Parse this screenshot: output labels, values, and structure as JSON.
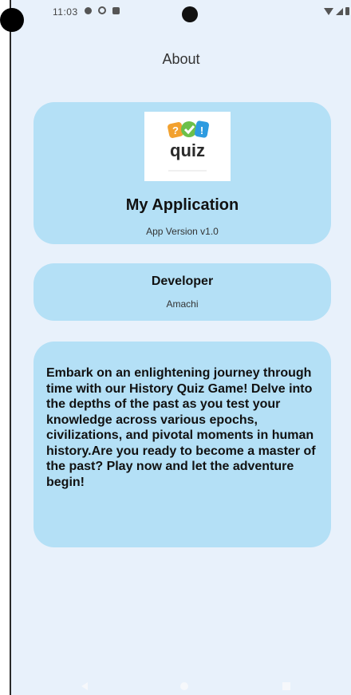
{
  "status_bar": {
    "time": "11:03",
    "icons": [
      "settings-icon",
      "location-icon",
      "sim-icon"
    ],
    "right_icons": [
      "wifi-icon",
      "signal-icon",
      "battery-icon"
    ]
  },
  "header": {
    "title": "About"
  },
  "app_card": {
    "logo_icon": "quiz-logo-icon",
    "logo_text": "quiz",
    "app_name": "My Application",
    "version": "App Version v1.0"
  },
  "developer_card": {
    "title": "Developer",
    "name": "Amachi"
  },
  "description_card": {
    "text": "Embark on an enlightening journey through time with our History Quiz Game! Delve into the depths of the past as you test your knowledge across various epochs, civilizations, and pivotal moments in human history.Are you ready to become a master of the past? Play now and let the adventure begin!"
  },
  "nav_bar": {
    "icons": [
      "back-icon",
      "home-icon",
      "recents-icon"
    ]
  },
  "colors": {
    "background": "#e8f1fb",
    "card": "#b4e0f6",
    "logo_orange": "#f2a12f",
    "logo_green": "#6cc04a",
    "logo_blue": "#2d9be0",
    "logo_text": "#2b2b2b"
  }
}
